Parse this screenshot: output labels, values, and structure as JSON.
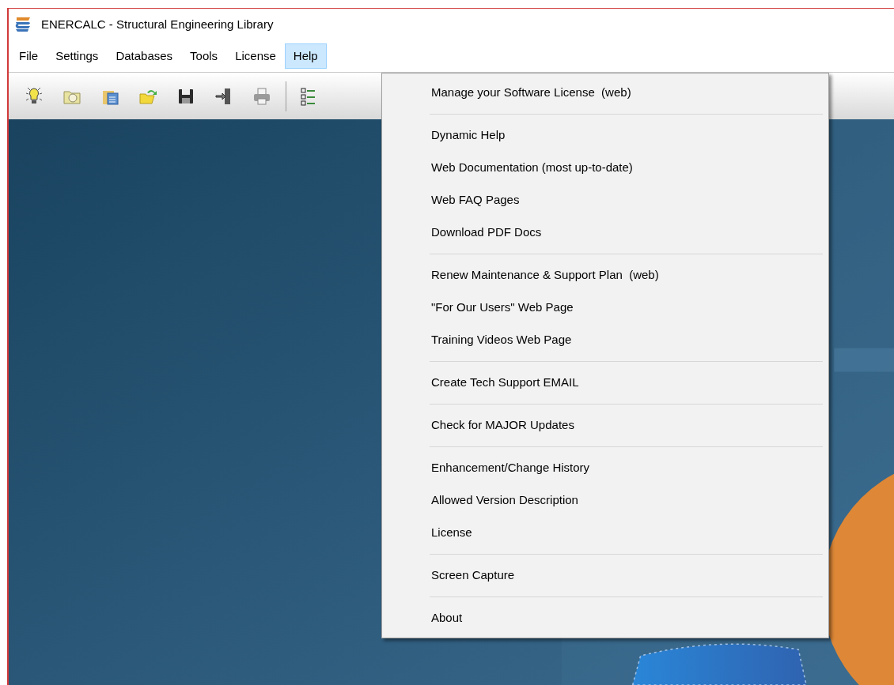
{
  "window": {
    "title": "ENERCALC - Structural Engineering Library"
  },
  "menu_bar": [
    {
      "label": "File",
      "selected": false
    },
    {
      "label": "Settings",
      "selected": false
    },
    {
      "label": "Databases",
      "selected": false
    },
    {
      "label": "Tools",
      "selected": false
    },
    {
      "label": "License",
      "selected": false
    },
    {
      "label": "Help",
      "selected": true
    }
  ],
  "help_menu": [
    {
      "kind": "item",
      "label": "Manage your Software License  (web)"
    },
    {
      "kind": "separator"
    },
    {
      "kind": "item",
      "label": "Dynamic Help"
    },
    {
      "kind": "item",
      "label": "Web Documentation (most up-to-date)"
    },
    {
      "kind": "item",
      "label": "Web FAQ Pages"
    },
    {
      "kind": "item",
      "label": "Download PDF Docs"
    },
    {
      "kind": "separator"
    },
    {
      "kind": "item",
      "label": "Renew Maintenance & Support Plan  (web)"
    },
    {
      "kind": "item",
      "label": "\"For Our Users\" Web Page"
    },
    {
      "kind": "item",
      "label": "Training Videos Web Page"
    },
    {
      "kind": "separator"
    },
    {
      "kind": "item",
      "label": "Create Tech Support EMAIL"
    },
    {
      "kind": "separator"
    },
    {
      "kind": "item",
      "label": "Check for MAJOR Updates"
    },
    {
      "kind": "separator"
    },
    {
      "kind": "item",
      "label": "Enhancement/Change History"
    },
    {
      "kind": "item",
      "label": "Allowed Version Description"
    },
    {
      "kind": "item",
      "label": "License"
    },
    {
      "kind": "separator"
    },
    {
      "kind": "item",
      "label": "Screen Capture"
    },
    {
      "kind": "separator"
    },
    {
      "kind": "item",
      "label": "About"
    }
  ]
}
